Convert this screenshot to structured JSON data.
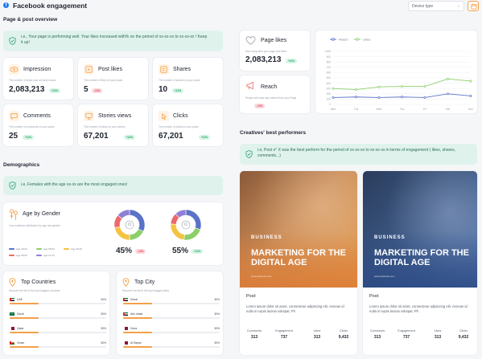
{
  "header": {
    "title": "Facebook engagement",
    "device_select": "Device type"
  },
  "overview": {
    "section_title": "Page & post overview",
    "alert": "i.e., Your page is performing well. Your likes increased with% on the period of xx-xx-xx to xx-xx-xx ! Keep it up!",
    "kpis": [
      {
        "title": "Impression",
        "sub": "The number of times your ad were shown",
        "value": "2,083,213",
        "badge": "+12%",
        "trend": "up"
      },
      {
        "title": "Post likes",
        "sub": "The number of likes on your posts",
        "value": "5",
        "badge": "-12%",
        "trend": "down"
      },
      {
        "title": "Shares",
        "sub": "The number of shares on your posts",
        "value": "10",
        "badge": "+12%",
        "trend": "up"
      },
      {
        "title": "Comments",
        "sub": "The number of comments on your posts",
        "value": "25",
        "badge": "+12%",
        "trend": "up"
      },
      {
        "title": "Stories views",
        "sub": "The number of views on your stories",
        "value": "67,201",
        "badge": "+12%",
        "trend": "up"
      },
      {
        "title": "Clicks",
        "sub": "The number of clicks on your posts",
        "value": "67,201",
        "badge": "+12%",
        "trend": "up"
      }
    ]
  },
  "page_stats": {
    "likes": {
      "title": "Page likes",
      "sub": "How many time your page was liked",
      "value": "2,083,213",
      "badge": "+12%"
    },
    "reach": {
      "title": "Reach",
      "sub": "People who saw any content from your Page",
      "badge": "-12%"
    }
  },
  "chart_data": {
    "type": "line",
    "categories": [
      "Mon",
      "Tue",
      "Wed",
      "Thu",
      "Fri",
      "Sat",
      "Sun"
    ],
    "series": [
      {
        "name": "Reach",
        "values": [
          130,
          140,
          130,
          140,
          130,
          200,
          160
        ],
        "color": "#5b72c9"
      },
      {
        "name": "Likes",
        "values": [
          300,
          280,
          330,
          340,
          340,
          480,
          440
        ],
        "color": "#8ccf6a"
      }
    ],
    "yticks": [
      "1000",
      "900",
      "800",
      "700",
      "600",
      "500",
      "400",
      "300",
      "200",
      "100",
      "0"
    ],
    "ylim": [
      0,
      1000
    ],
    "legend": "top-left",
    "grid": true
  },
  "demographics": {
    "section_title": "Demographics",
    "alert": "i.e, Females with the age xx-xx are the most engaged ones!",
    "age_gender": {
      "title": "Age by Gender",
      "sub": "Your audience distribution by age and gender",
      "legend": [
        {
          "label": "Age 18-24",
          "color": "#5b72c9"
        },
        {
          "label": "Age 55-64",
          "color": "#8ccf6a"
        },
        {
          "label": "Age 25-29",
          "color": "#f5c342"
        },
        {
          "label": "Age 65-55",
          "color": "#ec6a6a"
        },
        {
          "label": "Age 11-16",
          "color": "#8f7fd6"
        }
      ],
      "female": {
        "pct": "45%",
        "badge": "-12%",
        "slices": [
          0.32,
          0.18,
          0.22,
          0.14,
          0.14
        ]
      },
      "male": {
        "pct": "55%",
        "badge": "+12%",
        "slices": [
          0.3,
          0.22,
          0.24,
          0.12,
          0.12
        ]
      }
    },
    "top_countries": {
      "title": "Top Countries",
      "sub": "Discover the list of the top engaged countries",
      "rows": [
        {
          "name": "UAE",
          "pct": "30%",
          "value": 0.3
        },
        {
          "name": "Saudi",
          "pct": "30%",
          "value": 0.3
        },
        {
          "name": "Qatar",
          "pct": "30%",
          "value": 0.3
        },
        {
          "name": "Oman",
          "pct": "30%",
          "value": 0.3
        }
      ]
    },
    "top_city": {
      "title": "Top City",
      "sub": "Discover the list of the top engaged cities",
      "rows": [
        {
          "name": "Dubai",
          "pct": "30%",
          "value": 0.3
        },
        {
          "name": "Abu dhabi",
          "pct": "30%",
          "value": 0.3
        },
        {
          "name": "Doha",
          "pct": "30%",
          "value": 0.3
        },
        {
          "name": "Al Rayan",
          "pct": "30%",
          "value": 0.3
        }
      ]
    }
  },
  "creatives": {
    "section_title": "Creatives' best performers",
    "alert": "i.e, Post n° X was the best perform for the period of xx-xx-xx to xx-xx-xx in terms of engagement ( likes, shares, comments...)",
    "posts": [
      {
        "brand": "BUSINESS",
        "headline": "MARKETING FOR THE DIGITAL AGE",
        "url": "www.business.com",
        "post_label": "Post:",
        "text": "Lorem ipsum dolor sit amet, consectetur adipiscing elit. Aenean id nulla in turpis lacinia volutpat. Ph",
        "stats": [
          {
            "label": "Comments",
            "value": "313"
          },
          {
            "label": "Engagement",
            "value": "737"
          },
          {
            "label": "Likes",
            "value": "313"
          },
          {
            "label": "Clicks",
            "value": "9,432"
          }
        ]
      },
      {
        "brand": "BUSINESS",
        "headline": "MARKETING FOR THE DIGITAL AGE",
        "url": "www.business.com",
        "post_label": "Post:",
        "text": "Lorem ipsum dolor sit amet, consectetur adipiscing elit. Aenean id nulla in turpis lacinia volutpat. Ph",
        "stats": [
          {
            "label": "Comments",
            "value": "313"
          },
          {
            "label": "Engagement",
            "value": "737"
          },
          {
            "label": "Likes",
            "value": "313"
          },
          {
            "label": "Clicks",
            "value": "9,432"
          }
        ]
      }
    ]
  }
}
